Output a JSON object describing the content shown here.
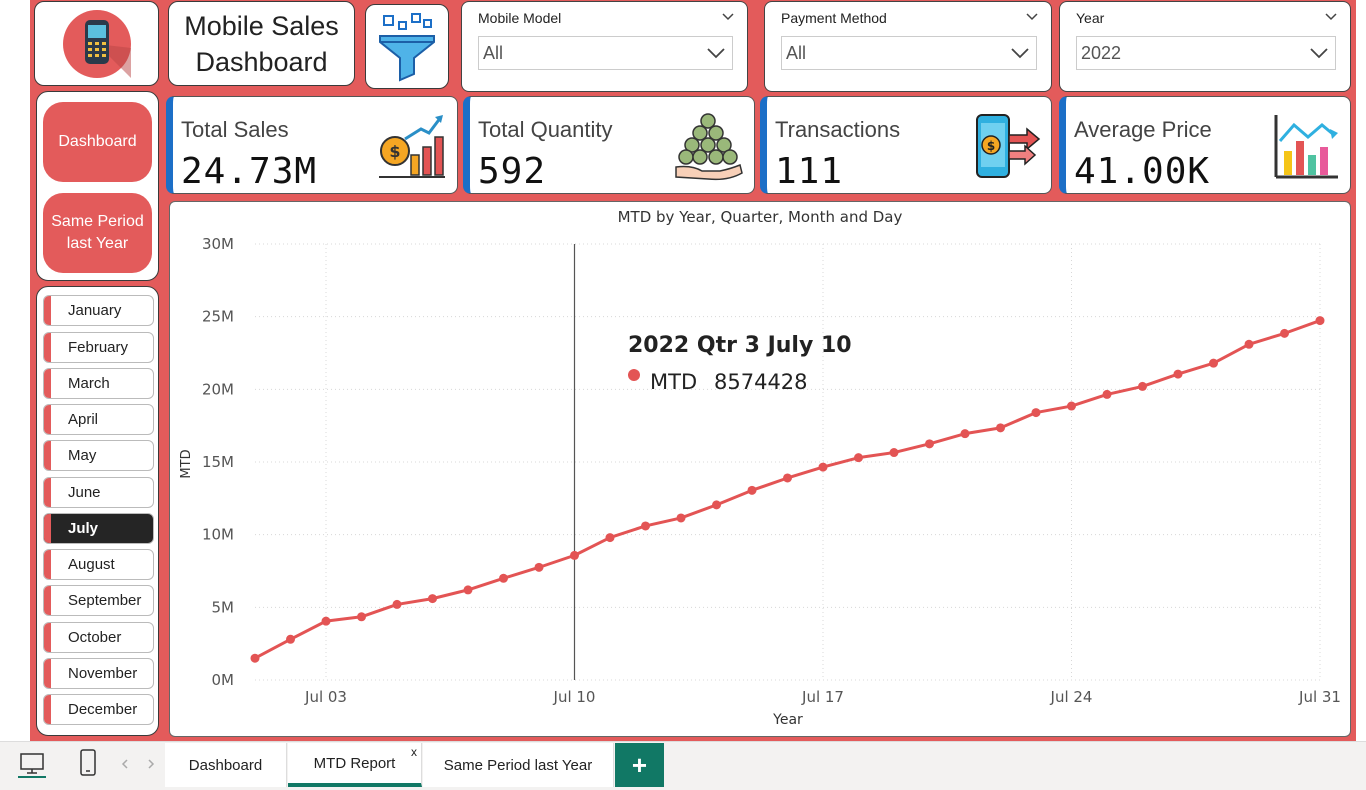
{
  "header": {
    "title_line1": "Mobile Sales",
    "title_line2": "Dashboard"
  },
  "slicers": [
    {
      "label": "Mobile Model",
      "value": "All"
    },
    {
      "label": "Payment Method",
      "value": "All"
    },
    {
      "label": "Year",
      "value": "2022"
    }
  ],
  "nav": {
    "dashboard": "Dashboard",
    "same_period_line1": "Same Period",
    "same_period_line2": "last Year"
  },
  "months": {
    "items": [
      "January",
      "February",
      "March",
      "April",
      "May",
      "June",
      "July",
      "August",
      "September",
      "October",
      "November",
      "December"
    ],
    "selected": "July"
  },
  "kpis": [
    {
      "label": "Total Sales",
      "value": "24.73M",
      "icon": "sales-growth-icon"
    },
    {
      "label": "Total Quantity",
      "value": "592",
      "icon": "coins-hand-icon"
    },
    {
      "label": "Transactions",
      "value": "111",
      "icon": "mobile-payment-icon"
    },
    {
      "label": "Average Price",
      "value": "41.00K",
      "icon": "bar-chart-icon"
    }
  ],
  "tooltip": {
    "title": "2022 Qtr 3 July 10",
    "series": "MTD",
    "value": "8574428"
  },
  "chart_data": {
    "type": "line",
    "title": "MTD by Year, Quarter, Month and Day",
    "xlabel": "Year",
    "ylabel": "MTD",
    "ylim": [
      0,
      30000000
    ],
    "yticks": [
      {
        "v": 0,
        "label": "0M"
      },
      {
        "v": 5000000,
        "label": "5M"
      },
      {
        "v": 10000000,
        "label": "10M"
      },
      {
        "v": 15000000,
        "label": "15M"
      },
      {
        "v": 20000000,
        "label": "20M"
      },
      {
        "v": 25000000,
        "label": "25M"
      },
      {
        "v": 30000000,
        "label": "30M"
      }
    ],
    "xticks": [
      {
        "d": 3,
        "label": "Jul 03"
      },
      {
        "d": 10,
        "label": "Jul 10"
      },
      {
        "d": 17,
        "label": "Jul 17"
      },
      {
        "d": 24,
        "label": "Jul 24"
      },
      {
        "d": 31,
        "label": "Jul 31"
      }
    ],
    "x": [
      1,
      2,
      3,
      4,
      5,
      6,
      7,
      8,
      9,
      10,
      11,
      12,
      13,
      14,
      15,
      16,
      17,
      18,
      19,
      20,
      21,
      22,
      23,
      24,
      25,
      26,
      27,
      28,
      29,
      30,
      31
    ],
    "series": [
      {
        "name": "MTD",
        "color": "#e35454",
        "values": [
          1500000,
          2800000,
          4050000,
          4350000,
          5200000,
          5600000,
          6200000,
          7000000,
          7750000,
          8574428,
          9800000,
          10600000,
          11150000,
          12050000,
          13050000,
          13900000,
          14650000,
          15300000,
          15650000,
          16250000,
          16950000,
          17350000,
          18400000,
          18850000,
          19650000,
          20200000,
          21050000,
          21800000,
          23100000,
          23850000,
          24730000
        ]
      }
    ],
    "highlight_x": 10,
    "grid": true
  },
  "tabs": {
    "items": [
      "Dashboard",
      "MTD Report",
      "Same Period last Year"
    ],
    "active": "MTD Report",
    "close": "x",
    "add": "+"
  },
  "colors": {
    "accent_red": "#e35b5b",
    "kpi_bar": "#1c6fc7",
    "tab_green": "#117865"
  }
}
